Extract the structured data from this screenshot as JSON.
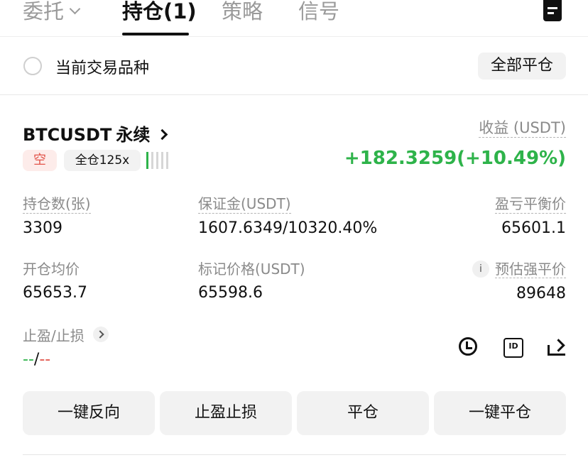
{
  "tabs": {
    "orders": "委托",
    "positions": "持仓(1)",
    "strategy": "策略",
    "signals": "信号"
  },
  "filter": {
    "current_symbol_label": "当前交易品种",
    "close_all_label": "全部平仓"
  },
  "position": {
    "symbol": "BTCUSDT",
    "contract_type": "永续",
    "side_tag": "空",
    "margin_mode_leverage": "全仓125x",
    "pnl_label": "收益 (USDT)",
    "pnl_value": "+182.3259(+10.49%)",
    "size_label": "持仓数(张)",
    "size_value": "3309",
    "margin_label": "保证金(USDT)",
    "margin_value": "1607.6349/10320.40%",
    "breakeven_label": "盈亏平衡价",
    "breakeven_value": "65601.1",
    "entry_label": "开仓均价",
    "entry_value": "65653.7",
    "mark_label": "标记价格(USDT)",
    "mark_value": "65598.6",
    "info_glyph": "i",
    "liq_label": "预估强平价",
    "liq_value": "89648",
    "tpsl_label": "止盈/止损",
    "tp_value": "--",
    "separator": "/",
    "sl_value": "--"
  },
  "actions": {
    "reverse": "一键反向",
    "tpsl": "止盈止损",
    "close": "平仓",
    "close_all": "一键平仓"
  },
  "colors": {
    "profit_green": "#2eb34a",
    "loss_red": "#e2544a",
    "muted": "#8a8a8a"
  },
  "icons": [
    "chevron-down-icon",
    "document-icon",
    "chevron-right-icon",
    "info-icon",
    "clock-icon",
    "id-card-icon",
    "share-icon"
  ]
}
